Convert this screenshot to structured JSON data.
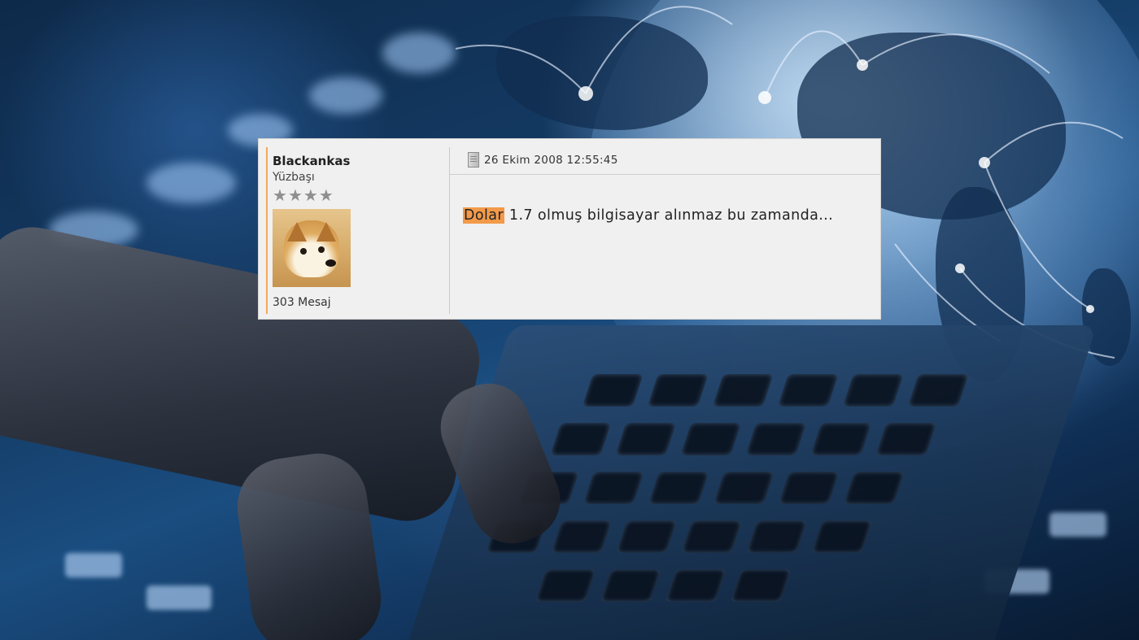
{
  "post": {
    "author": {
      "username": "Blackankas",
      "rank": "Yüzbaşı",
      "stars": [
        "★",
        "★",
        "★",
        "★"
      ],
      "message_count": "303 Mesaj"
    },
    "date": "26 Ekim 2008 12:55:45",
    "message": {
      "highlight": "Dolar",
      "text": " 1.7 olmuş bilgisayar alınmaz bu zamanda..."
    },
    "icons": {
      "date": "document-icon",
      "rating": "star-icon"
    },
    "colors": {
      "highlight": "#f29a4a",
      "accent_bar": "#f3a85a",
      "panel_bg": "#f0f0f0"
    }
  }
}
